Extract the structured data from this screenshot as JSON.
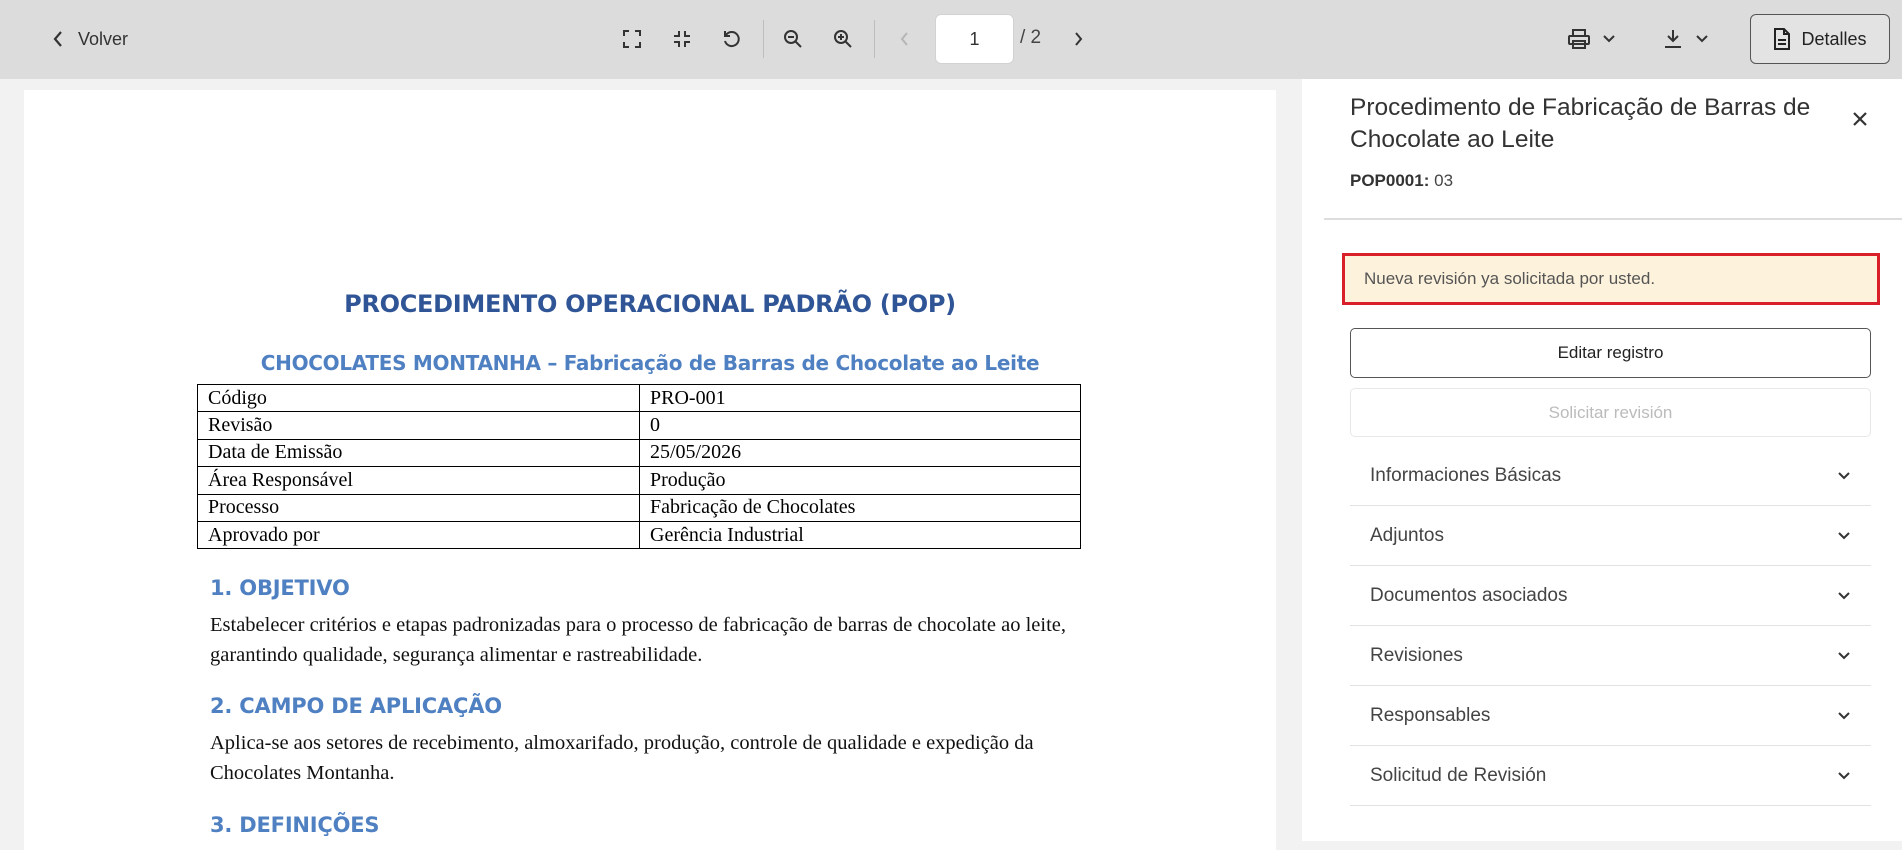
{
  "toolbar": {
    "back_label": "Volver",
    "current_page": "1",
    "total_pages": "/ 2",
    "details_label": "Detalles"
  },
  "document": {
    "title": "PROCEDIMENTO OPERACIONAL PADRÃO (POP)",
    "subtitle": "CHOCOLATES MONTANHA – Fabricação de Barras de Chocolate ao Leite",
    "table": [
      [
        "Código",
        "PRO-001"
      ],
      [
        "Revisão",
        "0"
      ],
      [
        "Data de Emissão",
        "25/05/2026"
      ],
      [
        "Área Responsável",
        "Produção"
      ],
      [
        "Processo",
        "Fabricação de Chocolates"
      ],
      [
        "Aprovado por",
        "Gerência Industrial"
      ]
    ],
    "sections": [
      {
        "heading": "1. OBJETIVO",
        "text": "Estabelecer critérios e etapas padronizadas para o processo de fabricação de barras de chocolate ao leite, garantindo qualidade, segurança alimentar e rastreabilidade."
      },
      {
        "heading": "2. CAMPO DE APLICAÇÃO",
        "text": "Aplica-se aos setores de recebimento, almoxarifado, produção, controle de qualidade e expedição da Chocolates Montanha."
      },
      {
        "heading": "3. DEFINIÇÕES",
        "text": ""
      }
    ]
  },
  "panel": {
    "title": "Procedimento de Fabricação de Barras de Chocolate ao Leite",
    "code_label": "POP0001:",
    "code_value": "03",
    "notice": "Nueva revisión ya solicitada por usted.",
    "edit_button": "Editar registro",
    "request_button": "Solicitar revisión",
    "accordion": [
      "Informaciones Básicas",
      "Adjuntos",
      "Documentos asociados",
      "Revisiones",
      "Responsables",
      "Solicitud de Revisión"
    ]
  },
  "colors": {
    "toolbar_bg": "#dcdcdc",
    "doc_heading": "#2f5596",
    "doc_section": "#4f80c2",
    "notice_border": "#d9202a",
    "notice_bg": "#fdf2dc"
  }
}
